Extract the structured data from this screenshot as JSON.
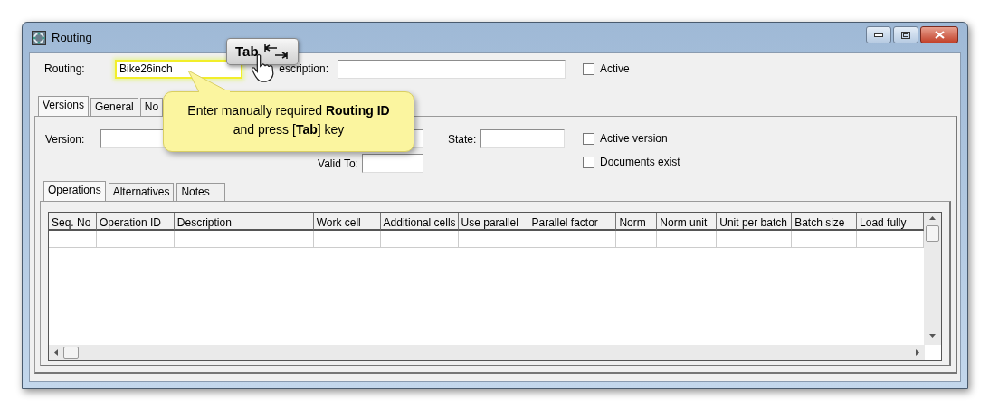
{
  "window": {
    "title": "Routing"
  },
  "header": {
    "routing_label": "Routing:",
    "routing_value": "Bike26inch",
    "description_label": "escription:",
    "active": {
      "label": "Active",
      "checked": false
    }
  },
  "tabs": [
    {
      "label": "Versions",
      "selected": true
    },
    {
      "label": "General",
      "selected": false
    },
    {
      "label": "No",
      "selected": false
    }
  ],
  "version_panel": {
    "version_label": "Version:",
    "valid_to_label": "Valid To:",
    "state_label": "State:",
    "checkboxes": [
      {
        "label": "Active version",
        "checked": false
      },
      {
        "label": "Documents exist",
        "checked": false
      }
    ]
  },
  "sub_tabs": [
    {
      "label": "Operations",
      "selected": true
    },
    {
      "label": "Alternatives",
      "selected": false
    },
    {
      "label": "Notes",
      "selected": false
    }
  ],
  "table": {
    "columns": [
      "Seq. No",
      "Operation ID",
      "Description",
      "Work cell",
      "Additional cells",
      "Use parallel",
      "Parallel factor",
      "Norm",
      "Norm unit",
      "Unit per batch",
      "Batch size",
      "Load fully"
    ]
  },
  "callout": {
    "text": "Enter manually required **Routing ID** and press [**Tab**] key"
  },
  "key_hint": {
    "label": "Tab"
  }
}
